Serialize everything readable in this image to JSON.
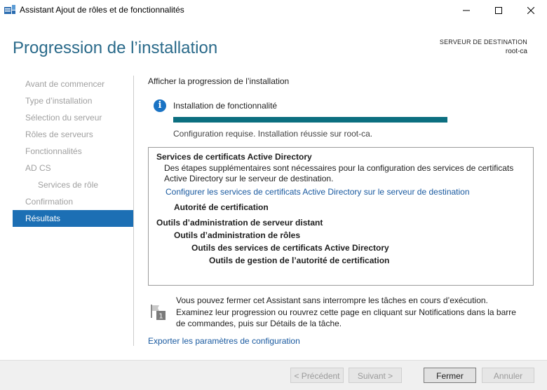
{
  "window": {
    "title": "Assistant Ajout de rôles et de fonctionnalités",
    "icon": "server-manager-icon"
  },
  "header": {
    "title": "Progression de l’installation",
    "destination_label": "SERVEUR DE DESTINATION",
    "destination_value": "root-ca"
  },
  "nav": {
    "items": [
      {
        "label": "Avant de commencer"
      },
      {
        "label": "Type d’installation"
      },
      {
        "label": "Sélection du serveur"
      },
      {
        "label": "Rôles de serveurs"
      },
      {
        "label": "Fonctionnalités"
      },
      {
        "label": "AD CS"
      },
      {
        "label": "Services de rôle"
      },
      {
        "label": "Confirmation"
      },
      {
        "label": "Résultats"
      }
    ],
    "active": "Résultats"
  },
  "main": {
    "section_label": "Afficher la progression de l’installation",
    "feature_title": "Installation de fonctionnalité",
    "progress_fraction": 1.0,
    "status": "Configuration requise. Installation réussie sur root-ca.",
    "results": {
      "title": "Services de certificats Active Directory",
      "description": "Des étapes supplémentaires sont nécessaires pour la configuration des services de certificats Active Directory sur le serveur de destination.",
      "link": "Configurer les services de certificats Active Directory sur le serveur de destination",
      "item1": "Autorité de certification",
      "heading2": "Outils d’administration de serveur distant",
      "item2": "Outils d’administration de rôles",
      "item3": "Outils des services de certificats Active Directory",
      "item4": "Outils de gestion de l’autorité de certification"
    },
    "note": "Vous pouvez fermer cet Assistant sans interrompre les tâches en cours d’exécution. Examinez leur progression ou rouvrez cette page en cliquant sur Notifications dans la barre de commandes, puis sur Détails de la tâche.",
    "export_link": "Exporter les paramètres de configuration"
  },
  "footer": {
    "prev": "< Précédent",
    "next": "Suivant >",
    "close": "Fermer",
    "cancel": "Annuler"
  },
  "colors": {
    "accent": "#1c6fb4",
    "title": "#2a6a8a",
    "progress": "#0c6f80",
    "link": "#1a5aa0"
  }
}
